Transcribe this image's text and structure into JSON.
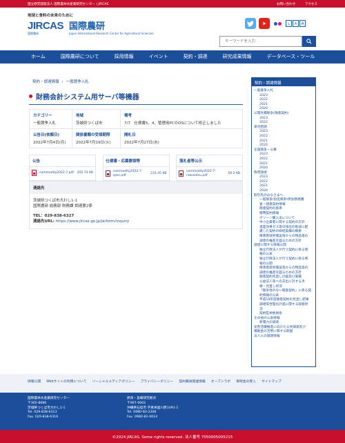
{
  "topbar": {
    "org": "国立研究開発法人 国際農林水産業研究センター | JIRCAS",
    "contact": "お問い合わせ",
    "access": "アクセス"
  },
  "header": {
    "tagline": "地球と食料の未来のために",
    "logo_mark": "JIRCAS",
    "logo_sub": "国際農研",
    "name_jp": "国際農研",
    "name_en": "Japan International Research Center for Agricultural Sciences",
    "font_sizes": [
      "A",
      "A",
      "A"
    ]
  },
  "search": {
    "placeholder": "キーワードを入力"
  },
  "nav": [
    "ホーム",
    "国際農研について",
    "採用情報",
    "イベント",
    "契約・調達",
    "研究成果情報",
    "データベース・ツール"
  ],
  "breadcrumb": {
    "parent": "契約・調達情報",
    "current": "一般競争入札"
  },
  "page_title": "財務会計システム用サーバ等機器",
  "info": {
    "category_label": "カテゴリー",
    "category": "一般競争入札",
    "region_label": "地域",
    "region": "茨城県つくば市",
    "note_label": "備考",
    "note": "7/7　仕様書5、4、管理用PCのOSについて修正しました",
    "date1_label": "公告日(依頼日)",
    "date1": "2022年7月4日(月)",
    "date2_label": "関係書類の受領期限",
    "date2": "2022年7月19日(火)",
    "date3_label": "開札日",
    "date3": "2022年7月27日(水)"
  },
  "files": [
    {
      "header": "公告",
      "name": "commodity2022-7.pdf",
      "size": "202.74 KB"
    },
    {
      "header": "仕様書・応募要領等",
      "name": "commodity2022-7-spec.pdf",
      "size": "231.45 KB"
    },
    {
      "header": "落札者等公示",
      "name": "commodity2022-7-rakusatsu.pdf",
      "size": "56.2 KB"
    }
  ],
  "contact": {
    "header": "連絡先",
    "address": "茨城県つくば市大わし1-1",
    "dept": "国際農研 総務部 財務課 調達第2係",
    "tel": "TEL：029-838-6327",
    "url_label": "連絡先URL:",
    "url": "https://www.jircas.go.jp/ja/form/inquiry"
  },
  "sidebar": {
    "title": "契約・調達情報",
    "items": [
      {
        "t": "一般競争入札",
        "lv": 1
      },
      {
        "t": "2023",
        "lv": 2
      },
      {
        "t": "2022",
        "lv": 2
      },
      {
        "t": "2021",
        "lv": 2
      },
      {
        "t": "2020",
        "lv": 2
      },
      {
        "t": "公開見積競争(隨意契約)",
        "lv": 1
      },
      {
        "t": "2023",
        "lv": 2
      },
      {
        "t": "2022",
        "lv": 2
      },
      {
        "t": "意見招請",
        "lv": 1
      },
      {
        "t": "2023",
        "lv": 2
      },
      {
        "t": "2022",
        "lv": 2
      },
      {
        "t": "2021",
        "lv": 2
      },
      {
        "t": "2020",
        "lv": 2
      },
      {
        "t": "企画競争・公募",
        "lv": 1
      },
      {
        "t": "2023",
        "lv": 2
      },
      {
        "t": "2022",
        "lv": 2
      },
      {
        "t": "2021",
        "lv": 2
      },
      {
        "t": "2020",
        "lv": 2
      },
      {
        "t": "政府調達",
        "lv": 1
      },
      {
        "t": "2023",
        "lv": 2
      },
      {
        "t": "2022",
        "lv": 2
      },
      {
        "t": "2021",
        "lv": 2
      },
      {
        "t": "2020",
        "lv": 2
      },
      {
        "t": "取引先のみなさまへ",
        "lv": 1
      },
      {
        "t": "一般競争(指名競争)参加資格審",
        "lv": 2
      },
      {
        "t": "査・随意契約情報",
        "lv": 2
      },
      {
        "t": "随意契約の基準",
        "lv": 2
      },
      {
        "t": "隨時契約情報",
        "lv": 2
      },
      {
        "t": "グリーン購入法について",
        "lv": 2
      },
      {
        "t": "中小企業者に関する契約の方針",
        "lv": 2
      },
      {
        "t": "温室効果ガス等の排出の削減に配",
        "lv": 2
      },
      {
        "t": "慮した契約の締結実績の概要",
        "lv": 2
      },
      {
        "t": "障害者就労施設等からの物品等の",
        "lv": 2
      },
      {
        "t": "調達の推進を図るための方針",
        "lv": 2
      },
      {
        "t": "調達に関する情報公開",
        "lv": 1
      },
      {
        "t": "独立行政法人が行う契約に係る情",
        "lv": 2
      },
      {
        "t": "報の公表",
        "lv": 2
      },
      {
        "t": "独立行政法人が行う契約に係る情",
        "lv": 2
      },
      {
        "t": "報の公開",
        "lv": 2
      },
      {
        "t": "障害者就労施設等からの物品等の",
        "lv": 2
      },
      {
        "t": "調達の推進を図るための方針",
        "lv": 2
      },
      {
        "t": "随意契約見直し計画及び実績",
        "lv": 2
      },
      {
        "t": "公益法人等への支出に対する点",
        "lv": 2
      },
      {
        "t": "検・見直し状況",
        "lv": 2
      },
      {
        "t": "「競争性のない随意契約」に係る契",
        "lv": 2
      },
      {
        "t": "約情報の公表",
        "lv": 2
      },
      {
        "t": "平成18年度随意契約の見直し結果",
        "lv": 2
      },
      {
        "t": "調達等合理化計画に関する取組状",
        "lv": 2
      },
      {
        "t": "況",
        "lv": 2
      },
      {
        "t": "契約監視委員会",
        "lv": 2
      },
      {
        "t": "その他の公表情報",
        "lv": 1
      },
      {
        "t": "新電力の調達",
        "lv": 2
      },
      {
        "t": "女性活躍推進に向けた公共調達及び",
        "lv": 1
      },
      {
        "t": "補助金の活用に関する取組",
        "lv": 1
      },
      {
        "t": "法人入の調達情報",
        "lv": 1
      }
    ]
  },
  "footer_links": [
    "情報公開",
    "Webサイトの利用について",
    "ソーシャルメディアポリシー",
    "プライバシーポリシー",
    "契約職員関連情報",
    "オープンラボ",
    "寄附金の受入",
    "サイトマップ"
  ],
  "footer": {
    "left": [
      "国際農林水産業研究センター",
      "〒305-8686",
      "茨城県つくば市大わし1-1",
      "Tel. 029-838-6313",
      "Fax. 029-838-6316"
    ],
    "right": [
      "熱帯・島嶼研究拠点",
      "〒907-0002",
      "沖縄県石垣市 字真栄里川原1091-1",
      "Tel. 0980-82-2306",
      "Fax. 0980-82-0614"
    ]
  },
  "copyright": "©2024 JIRCAS. Some rights reserved. 法人番号 7050005005215"
}
